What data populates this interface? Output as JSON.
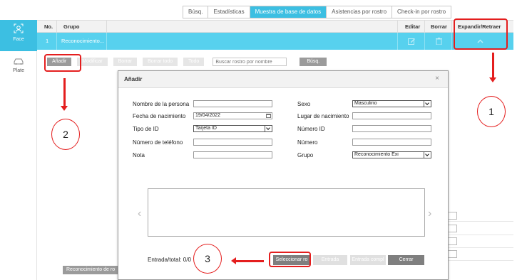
{
  "tabs": [
    "Búsq.",
    "Estadísticas",
    "Muestra de base de datos",
    "Asistencias por rostro",
    "Check-in por rostro"
  ],
  "active_tab": "Muestra de base de datos",
  "sidebar": {
    "face_label": "Face",
    "plate_label": "Plate"
  },
  "table": {
    "headers": {
      "no": "No.",
      "group": "Grupo",
      "edit": "Editar",
      "delete": "Borrar",
      "expand": "Expandir/Retraer"
    },
    "row": {
      "no": "1",
      "group": "Reconocimiento..."
    }
  },
  "toolbar": {
    "add": "Añadir",
    "modify": "Modificar",
    "delete": "Borrar",
    "delete_all": "Borrar todo",
    "all": "Todo",
    "search_placeholder": "Buscar rostro por nombre",
    "search": "Búsq."
  },
  "bottom_tag": "Reconocimiento de ro",
  "dialog": {
    "title": "Añadir",
    "close": "×",
    "fields": {
      "name_label": "Nombre de la persona",
      "name_value": "",
      "birth_label": "Fecha de nacimiento",
      "birth_value": "19/04/2022",
      "id_type_label": "Tipo de ID",
      "id_type_value": "Tarjeta ID",
      "phone_label": "Número de teléfono",
      "phone_value": "",
      "note_label": "Nota",
      "note_value": "",
      "sex_label": "Sexo",
      "sex_value": "Masculino",
      "birthplace_label": "Lugar de nacimiento",
      "birthplace_value": "",
      "id_number_label": "Número ID",
      "id_number_value": "",
      "number_label": "Número",
      "number_value": "",
      "group_label": "Grupo",
      "group_value": "Reconocimiento Exi"
    },
    "status": "Entrada/total: 0/0",
    "buttons": {
      "select": "Seleccionar ro",
      "entry": "Entrada",
      "entry_full": "Entrada compl",
      "close": "Cerrar"
    }
  },
  "annotations": {
    "one": "1",
    "two": "2",
    "three": "3"
  },
  "colors": {
    "accent": "#3cbfe2",
    "row_selected": "#57d1ee",
    "annotation": "#e41e1e"
  }
}
